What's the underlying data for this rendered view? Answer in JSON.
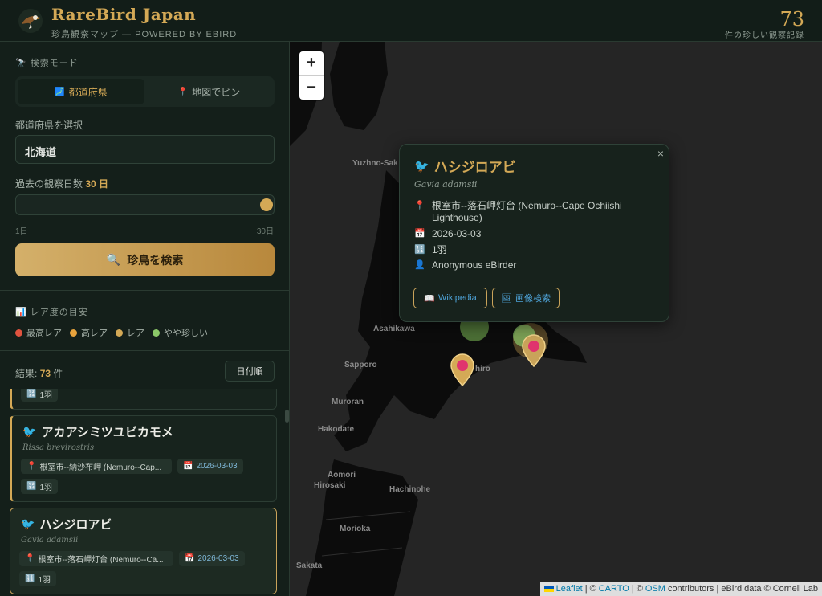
{
  "header": {
    "title": "RareBird Japan",
    "subtitle": "珍鳥観察マップ — POWERED BY EBIRD",
    "count": "73",
    "count_label": "件の珍しい観察記録"
  },
  "sidebar": {
    "mode_label": "検索モード",
    "mode_prefecture": "都道府県",
    "mode_pin": "地図でピン",
    "prefecture_label": "都道府県を選択",
    "prefecture_value": "北海道",
    "days_label": "過去の観察日数",
    "days_value": "30 日",
    "slider_value": 30,
    "slider_min": "1日",
    "slider_max": "30日",
    "search_button": "珍鳥を検索",
    "legend_label": "レア度の目安",
    "legend": [
      {
        "label": "最高レア",
        "color": "#e0533f"
      },
      {
        "label": "高レア",
        "color": "#e8a33c"
      },
      {
        "label": "レア",
        "color": "#d4a956"
      },
      {
        "label": "やや珍しい",
        "color": "#8bc868"
      }
    ],
    "results_prefix": "結果:",
    "results_count": "73",
    "results_suffix": "件",
    "sort_button": "日付順"
  },
  "list": {
    "prev_count": "1羽",
    "items": [
      {
        "name": "アカアシミツユビカモメ",
        "sci": "Rissa brevirostris",
        "location": "根室市--納沙布岬 (Nemuro--Cap...",
        "date": "2026-03-03",
        "count": "1羽"
      },
      {
        "name": "ハシジロアビ",
        "sci": "Gavia adamsii",
        "location": "根室市--落石岬灯台 (Nemuro--Ca...",
        "date": "2026-03-03",
        "count": "1羽"
      }
    ]
  },
  "map": {
    "zoom_in": "+",
    "zoom_out": "−",
    "cities": {
      "yuzhno": "Yuzhno-Sak",
      "asahikawa": "Asahikawa",
      "sapporo": "Sapporo",
      "kushiro": "hiro",
      "muroran": "Muroran",
      "hakodate": "Hakodate",
      "aomori": "Aomori",
      "hirosaki": "Hirosaki",
      "hachinohe": "Hachinohe",
      "morioka": "Morioka",
      "sakata": "Sakata"
    },
    "attribution": {
      "leaflet": "Leaflet",
      "sep1": "| ©",
      "carto": "CARTO",
      "sep2": "| ©",
      "osm": "OSM",
      "rest": "contributors | eBird data © Cornell Lab"
    }
  },
  "popup": {
    "close": "×",
    "title": "ハシジロアビ",
    "sci": "Gavia adamsii",
    "location": "根室市--落石岬灯台 (Nemuro--Cape Ochiishi Lighthouse)",
    "date": "2026-03-03",
    "count": "1羽",
    "observer": "Anonymous eBirder",
    "btn_wiki": "Wikipedia",
    "btn_image": "画像検索"
  }
}
